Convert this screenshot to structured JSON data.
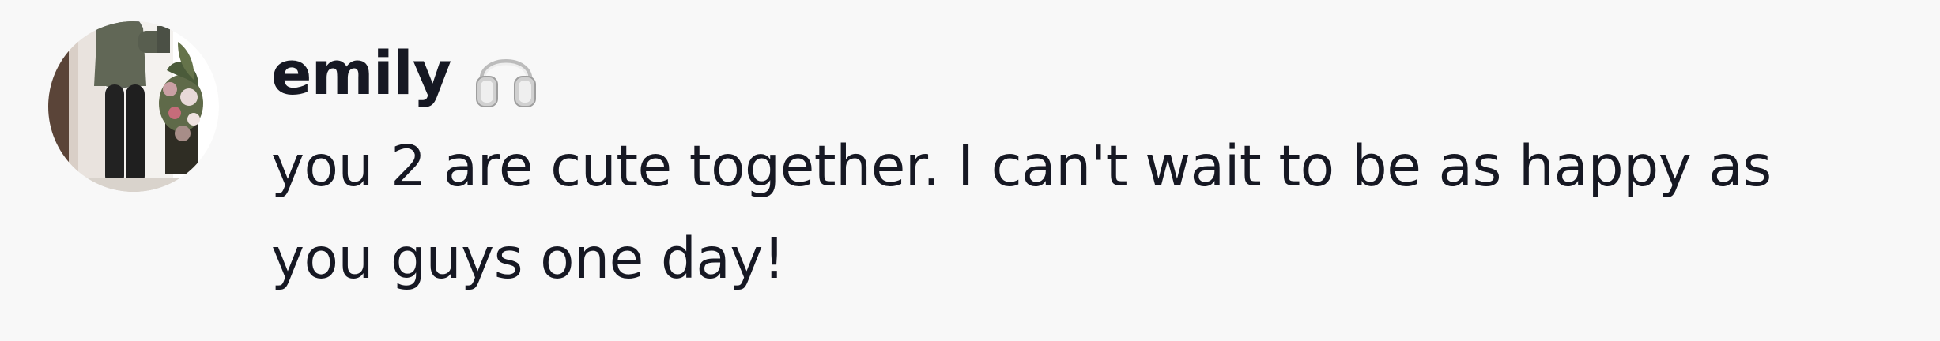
{
  "comment": {
    "username": "emily",
    "username_icon": "headphones-icon",
    "text_lines": [
      "you 2 are cute together. I can't wait to be as happy as",
      "you guys one day!"
    ]
  },
  "colors": {
    "background": "#f8f8f8",
    "text": "#161823"
  }
}
